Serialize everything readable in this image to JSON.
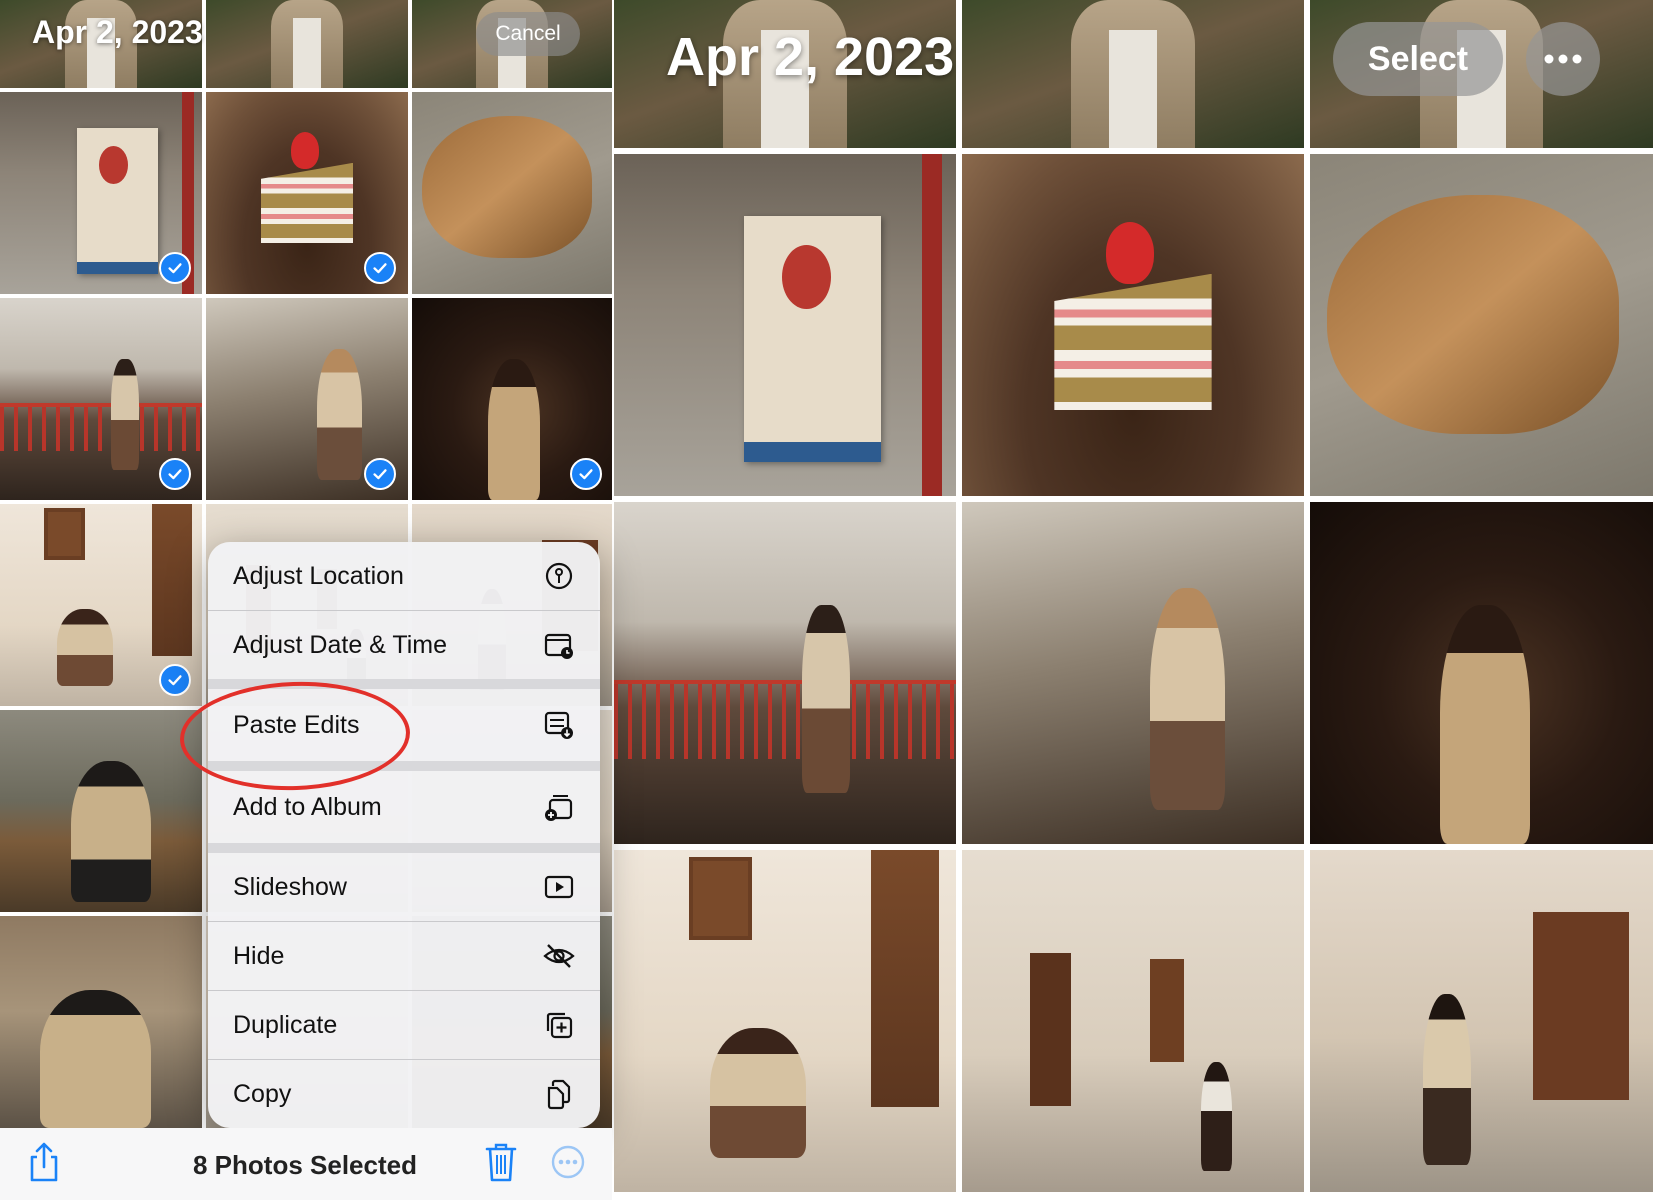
{
  "left_panel": {
    "date": "Apr 2, 2023",
    "cancel_label": "Cancel"
  },
  "right_panel": {
    "date": "Apr 2, 2023",
    "select_label": "Select"
  },
  "context_menu": {
    "items": [
      {
        "label": "Adjust Location",
        "icon": "location-pin-icon"
      },
      {
        "label": "Adjust Date & Time",
        "icon": "calendar-clock-icon"
      },
      {
        "label": "Paste Edits",
        "icon": "paste-edits-icon"
      },
      {
        "label": "Add to Album",
        "icon": "add-to-album-icon"
      },
      {
        "label": "Slideshow",
        "icon": "play-icon"
      },
      {
        "label": "Hide",
        "icon": "eye-slash-icon"
      },
      {
        "label": "Duplicate",
        "icon": "duplicate-icon"
      },
      {
        "label": "Copy",
        "icon": "copy-icon"
      }
    ]
  },
  "toolbar": {
    "selected_count_label": "8 Photos Selected"
  },
  "colors": {
    "selection_blue": "#1a82f7",
    "highlight_red": "#e2302a",
    "toolbar_blue": "#1a82f7"
  }
}
